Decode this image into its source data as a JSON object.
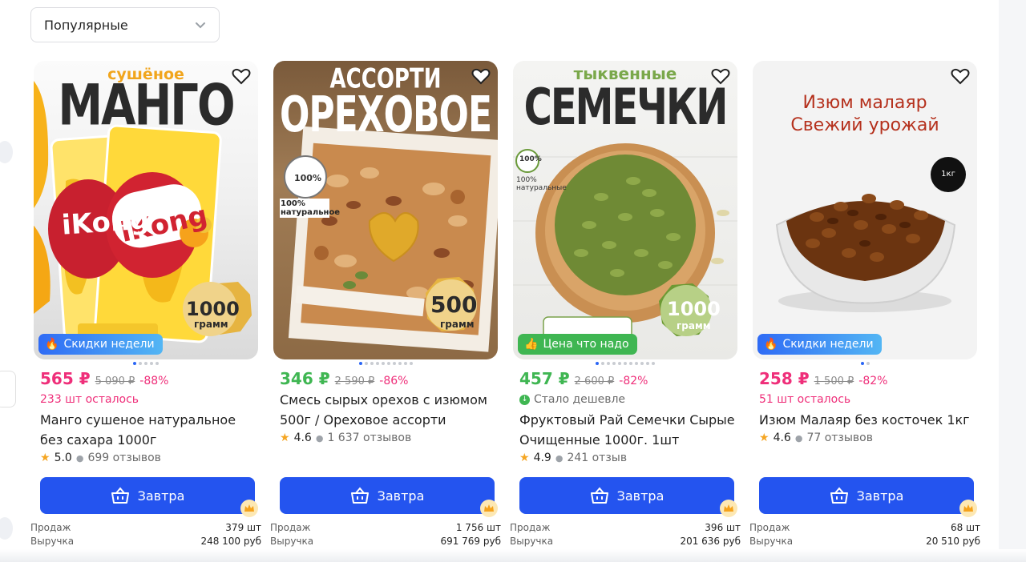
{
  "sort": {
    "label": "Популярные"
  },
  "products": [
    {
      "image": {
        "top_text": "сушёное",
        "main_text": "МАНГО",
        "brand": "iKong",
        "badge_num": "1000",
        "badge_unit": "грамм"
      },
      "promo": "Скидки недели",
      "price": "565 ₽",
      "old_price": "5 090 ₽",
      "discount": "-88%",
      "status": "233 шт осталось",
      "title": "Манго сушеное натуральное без сахара 1000г",
      "rating": "5.0",
      "reviews": "699 отзывов",
      "button": "Завтра",
      "sales_label": "Продаж",
      "sales": "379 шт",
      "revenue_label": "Выручка",
      "revenue": "248 100 руб"
    },
    {
      "image": {
        "top_text": "АССОРТИ",
        "main_text": "ОРЕХОВОЕ",
        "badge_num": "500",
        "badge_unit": "грамм",
        "percent": "100%",
        "natural": "100% натуральное"
      },
      "promo": "",
      "price": "346 ₽",
      "old_price": "2 590 ₽",
      "discount": "-86%",
      "status": "",
      "title": "Смесь сырых орехов с изюмом 500г / Ореховое ассорти",
      "rating": "4.6",
      "reviews": "1 637 отзывов",
      "button": "Завтра",
      "sales_label": "Продаж",
      "sales": "1 756 шт",
      "revenue_label": "Выручка",
      "revenue": "691 769 руб"
    },
    {
      "image": {
        "top_text": "тыквенные",
        "main_text": "СЕМЕЧКИ",
        "badge_num": "1000",
        "badge_unit": "грамм",
        "percent": "100%",
        "natural": "100% натуральные"
      },
      "promo": "Цена что надо",
      "price": "457 ₽",
      "old_price": "2 600 ₽",
      "discount": "-82%",
      "status": "Стало дешевле",
      "title": "Фруктовый Рай Семечки Сырые Очищенные 1000г. 1шт",
      "rating": "4.9",
      "reviews": "241 отзыв",
      "button": "Завтра",
      "sales_label": "Продаж",
      "sales": "396 шт",
      "revenue_label": "Выручка",
      "revenue": "201 636 руб"
    },
    {
      "image": {
        "line1": "Изюм малаяр",
        "line2": "Свежий урожай",
        "badge": "1кг"
      },
      "promo": "Скидки недели",
      "price": "258 ₽",
      "old_price": "1 500 ₽",
      "discount": "-82%",
      "status": "51 шт осталось",
      "title": "Изюм Малаяр без косточек 1кг",
      "rating": "4.6",
      "reviews": "77 отзывов",
      "button": "Завтра",
      "sales_label": "Продаж",
      "sales": "68 шт",
      "revenue_label": "Выручка",
      "revenue": "20 510 руб"
    }
  ],
  "colors": {
    "accent": "#2454ef",
    "price_pink": "#ef2f7a",
    "price_green": "#3fb652"
  }
}
